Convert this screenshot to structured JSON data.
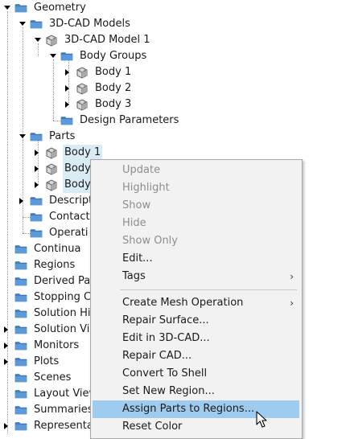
{
  "tree": {
    "geometry": "Geometry",
    "cad_models": "3D-CAD Models",
    "cad_model_1": "3D-CAD Model 1",
    "body_groups": "Body Groups",
    "body_1": "Body 1",
    "body_2": "Body 2",
    "body_3": "Body 3",
    "design_parameters": "Design Parameters",
    "parts": "Parts",
    "part_body_1": "Body 1",
    "part_body_2": "Body",
    "part_body_3": "Body",
    "descriptions": "Descript",
    "contacts": "Contacts",
    "operations": "Operati",
    "continua": "Continua",
    "regions": "Regions",
    "derived_parts": "Derived Par",
    "stopping_criteria": "Stopping Cr",
    "solution_histories": "Solution Hi",
    "solution_views": "Solution Vi",
    "monitors": "Monitors",
    "plots": "Plots",
    "scenes": "Scenes",
    "layout_views": "Layout View",
    "summaries": "Summaries",
    "representations": "Representat"
  },
  "context_menu": {
    "update": "Update",
    "highlight": "Highlight",
    "show": "Show",
    "hide": "Hide",
    "show_only": "Show Only",
    "edit": "Edit...",
    "tags": "Tags",
    "create_mesh_operation": "Create Mesh Operation",
    "repair_surface": "Repair Surface...",
    "edit_in_3d_cad": "Edit in 3D-CAD...",
    "repair_cad": "Repair CAD...",
    "convert_to_shell": "Convert To Shell",
    "set_new_region": "Set New Region...",
    "assign_parts_to_regions": "Assign Parts to Regions...",
    "reset_color": "Reset Color"
  },
  "icons": {
    "expanded": "triangle-down-icon",
    "collapsed": "triangle-right-icon",
    "folder": "folder-icon",
    "cad_body": "cad-body-icon",
    "submenu": "chevron-right-icon",
    "pointer": "mouse-pointer-icon"
  },
  "colors": {
    "folder": "#3d7fc4",
    "selection": "#d9ecf3",
    "menu_background": "#f2f2f2",
    "menu_highlight": "#9fcbef",
    "disabled_text": "#8e8e8e"
  }
}
